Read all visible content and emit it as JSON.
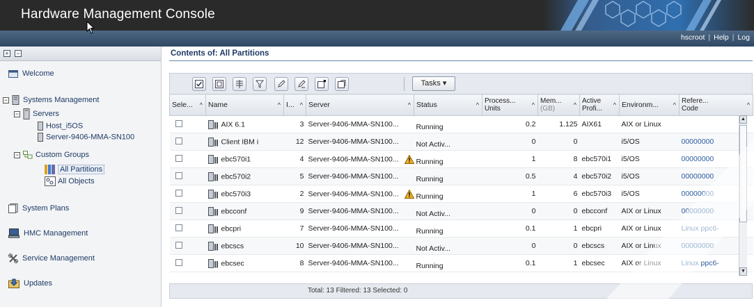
{
  "app": {
    "title": "Hardware Management Console"
  },
  "userbar": {
    "user": "hscroot",
    "help": "Help",
    "logoff": "Log"
  },
  "nav": {
    "welcome": "Welcome",
    "systems_management": "Systems Management",
    "servers": "Servers",
    "server_1": "Host_i5OS",
    "server_2": "Server-9406-MMA-SN100",
    "custom_groups": "Custom Groups",
    "all_partitions": "All Partitions",
    "all_objects": "All Objects",
    "system_plans": "System Plans",
    "hmc_management": "HMC Management",
    "service_management": "Service Management",
    "updates": "Updates"
  },
  "main": {
    "contents_title": "Contents of: All Partitions",
    "tasks_label": "Tasks ▾",
    "footer": "Total: 13   Filtered: 13   Selected: 0"
  },
  "table": {
    "headers": {
      "select": "Sele...",
      "name": "Name",
      "id": "I...",
      "server": "Server",
      "status": "Status",
      "proc_1": "Process...",
      "proc_2": "Units",
      "mem_1": "Mem...",
      "mem_2": "(GB)",
      "active_1": "Active",
      "active_2": "Profi...",
      "env": "Environm...",
      "ref_1": "Refere...",
      "ref_2": "Code"
    },
    "rows": [
      {
        "name": "AIX 6.1",
        "id": "3",
        "server": "Server-9406-MMA-SN100...",
        "status": "Running",
        "proc": "0.2",
        "mem": "1.125",
        "profile": "AIX61",
        "env": "AIX or Linux",
        "ref": "",
        "warn": false
      },
      {
        "name": "Client IBM i",
        "id": "12",
        "server": "Server-9406-MMA-SN100...",
        "status": "Not Activ...",
        "proc": "0",
        "mem": "0",
        "profile": "",
        "env": "i5/OS",
        "ref": "00000000",
        "warn": false
      },
      {
        "name": "ebc570i1",
        "id": "4",
        "server": "Server-9406-MMA-SN100...",
        "status": "Running",
        "proc": "1",
        "mem": "8",
        "profile": "ebc570i1",
        "env": "i5/OS",
        "ref": "00000000",
        "warn": true
      },
      {
        "name": "ebc570i2",
        "id": "5",
        "server": "Server-9406-MMA-SN100...",
        "status": "Running",
        "proc": "0.5",
        "mem": "4",
        "profile": "ebc570i2",
        "env": "i5/OS",
        "ref": "00000000",
        "warn": false
      },
      {
        "name": "ebc570i3",
        "id": "2",
        "server": "Server-9406-MMA-SN100...",
        "status": "Running",
        "proc": "1",
        "mem": "6",
        "profile": "ebc570i3",
        "env": "i5/OS",
        "ref": "00000000",
        "warn": true
      },
      {
        "name": "ebcconf",
        "id": "9",
        "server": "Server-9406-MMA-SN100...",
        "status": "Not Activ...",
        "proc": "0",
        "mem": "0",
        "profile": "ebcconf",
        "env": "AIX or Linux",
        "ref": "00000000",
        "warn": false
      },
      {
        "name": "ebcpri",
        "id": "7",
        "server": "Server-9406-MMA-SN100...",
        "status": "Running",
        "proc": "0.1",
        "mem": "1",
        "profile": "ebcpri",
        "env": "AIX or Linux",
        "ref": "Linux ppc6-",
        "warn": false
      },
      {
        "name": "ebcscs",
        "id": "10",
        "server": "Server-9406-MMA-SN100...",
        "status": "Not Activ...",
        "proc": "0",
        "mem": "0",
        "profile": "ebcscs",
        "env": "AIX or Linux",
        "ref": "00000000",
        "warn": false
      },
      {
        "name": "ebcsec",
        "id": "8",
        "server": "Server-9406-MMA-SN100...",
        "status": "Running",
        "proc": "0.1",
        "mem": "1",
        "profile": "ebcsec",
        "env": "AIX or Linux",
        "ref": "Linux ppc6-",
        "warn": false
      }
    ]
  }
}
